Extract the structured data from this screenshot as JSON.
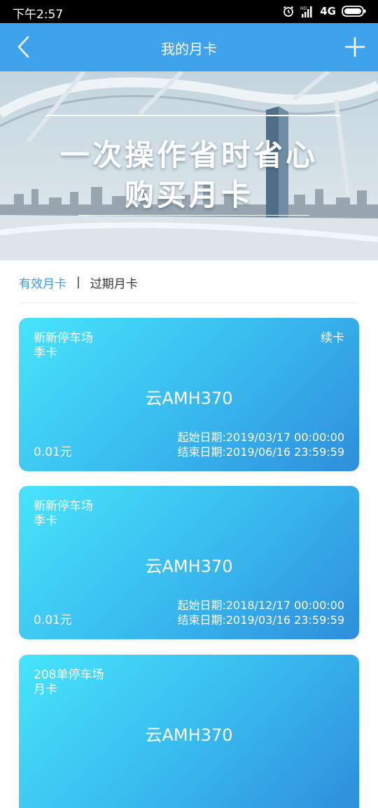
{
  "status_bar": {
    "time": "下午2:57",
    "network": "4G",
    "alarm_icon": "alarm-clock-icon",
    "signal_icon": "signal-bars-icon",
    "battery_icon": "battery-icon"
  },
  "nav": {
    "title": "我的月卡",
    "back_icon": "chevron-left-icon",
    "add_icon": "plus-icon",
    "color": "#3fa2ec"
  },
  "banner": {
    "line1": "一次操作省时省心",
    "line2": "购买月卡"
  },
  "tabs": {
    "active": "有效月卡",
    "separator": "|",
    "inactive": "过期月卡",
    "active_color": "#3b9be6"
  },
  "cards": [
    {
      "lot": "新新停车场",
      "type": "季卡",
      "action": "续卡",
      "plate": "云AMH370",
      "price": "0.01元",
      "start": "起始日期:2019/03/17 00:00:00",
      "end": "结束日期:2019/06/16 23:59:59"
    },
    {
      "lot": "新新停车场",
      "type": "季卡",
      "plate": "云AMH370",
      "price": "0.01元",
      "start": "起始日期:2018/12/17 00:00:00",
      "end": "结束日期:2019/03/16 23:59:59"
    },
    {
      "lot": "208单停车场",
      "type": "月卡",
      "plate": "云AMH370"
    }
  ]
}
